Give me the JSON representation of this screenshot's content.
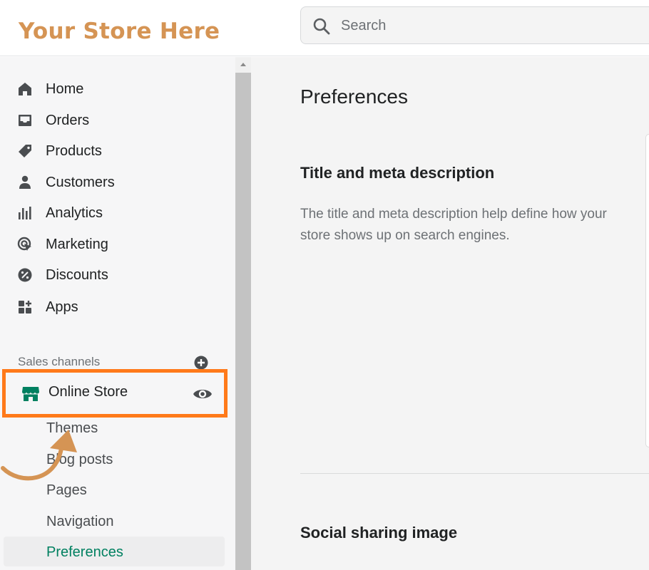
{
  "brand": {
    "name": "Your Store Here",
    "color": "#d59454"
  },
  "search": {
    "placeholder": "Search",
    "icon": "search-icon"
  },
  "sidebar": {
    "items": [
      {
        "label": "Home",
        "icon": "home-icon"
      },
      {
        "label": "Orders",
        "icon": "inbox-icon"
      },
      {
        "label": "Products",
        "icon": "tag-icon"
      },
      {
        "label": "Customers",
        "icon": "person-icon"
      },
      {
        "label": "Analytics",
        "icon": "bar-chart-icon"
      },
      {
        "label": "Marketing",
        "icon": "target-icon"
      },
      {
        "label": "Discounts",
        "icon": "discount-icon"
      },
      {
        "label": "Apps",
        "icon": "apps-icon"
      }
    ],
    "sales_channels_label": "Sales channels",
    "online_store": {
      "label": "Online Store",
      "icon": "store-icon",
      "highlight_color": "#ff7a1a"
    },
    "sub_items": [
      {
        "label": "Themes"
      },
      {
        "label": "Blog posts"
      },
      {
        "label": "Pages"
      },
      {
        "label": "Navigation"
      },
      {
        "label": "Preferences",
        "active": true
      }
    ],
    "active_color": "#008060"
  },
  "main": {
    "title": "Preferences",
    "sections": [
      {
        "title": "Title and meta description",
        "description": "The title and meta description help define how your store shows up on search engines."
      },
      {
        "title": "Social sharing image"
      }
    ]
  }
}
